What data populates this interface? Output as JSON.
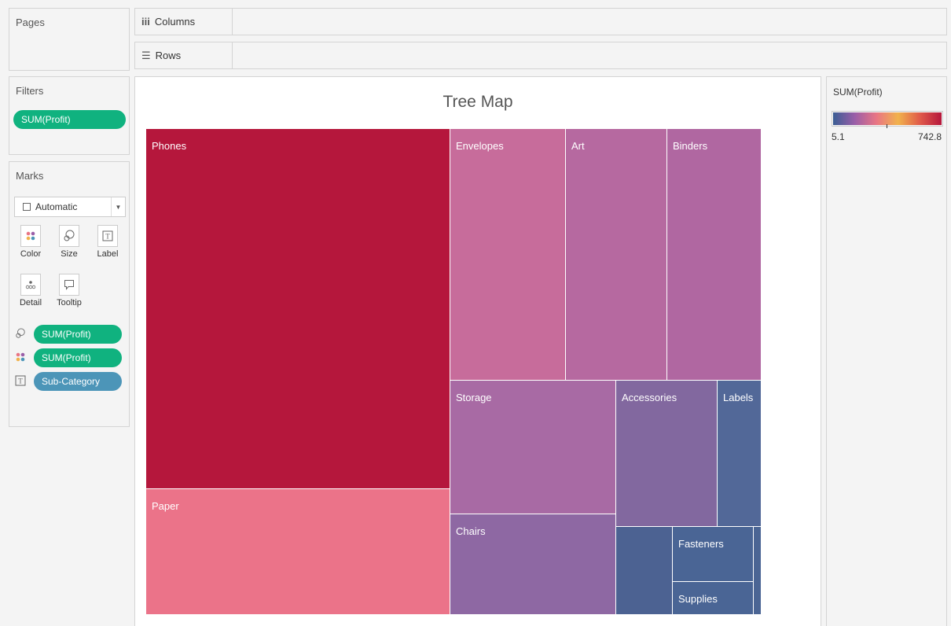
{
  "pages": {
    "title": "Pages"
  },
  "shelves": {
    "columns": {
      "icon": "iii",
      "label": "Columns"
    },
    "rows": {
      "icon": "☰",
      "label": "Rows"
    }
  },
  "filters": {
    "title": "Filters",
    "pills": [
      "SUM(Profit)"
    ]
  },
  "marks": {
    "title": "Marks",
    "type": "Automatic",
    "buttons": {
      "color": "Color",
      "size": "Size",
      "label": "Label",
      "detail": "Detail",
      "tooltip": "Tooltip"
    },
    "fields": [
      {
        "icon": "size-icon",
        "label": "SUM(Profit)"
      },
      {
        "icon": "color-icon",
        "label": "SUM(Profit)"
      },
      {
        "icon": "label-icon",
        "label": "Sub-Category"
      }
    ]
  },
  "legend": {
    "title": "SUM(Profit)",
    "min": "5.1",
    "max": "742.8"
  },
  "colors": {
    "legend_gradient": [
      "#3b5e94",
      "#9a5ea8",
      "#e97584",
      "#f1b24c",
      "#e05a4a",
      "#b5173c"
    ],
    "pill_green": "#10b27f",
    "pill_blue": "#4c95b8"
  },
  "chart_data": {
    "type": "treemap",
    "title": "Tree Map",
    "measure": "SUM(Profit)",
    "dimension": "Sub-Category",
    "items": [
      {
        "label": "Phones",
        "color": "#b5173c"
      },
      {
        "label": "Paper",
        "color": "#eb7389"
      },
      {
        "label": "Envelopes",
        "color": "#c76c9b"
      },
      {
        "label": "Art",
        "color": "#b669a0"
      },
      {
        "label": "Binders",
        "color": "#b067a1"
      },
      {
        "label": "Storage",
        "color": "#a86aa4"
      },
      {
        "label": "Chairs",
        "color": "#8e68a3"
      },
      {
        "label": "Accessories",
        "color": "#82689f"
      },
      {
        "label": "Labels",
        "color": "#526898"
      },
      {
        "label": "Fasteners",
        "color": "#4a6595"
      },
      {
        "label": "Supplies",
        "color": "#4a6595"
      },
      {
        "label": "",
        "color": "#4c6292"
      },
      {
        "label": "",
        "color": "#4b6594"
      }
    ]
  }
}
